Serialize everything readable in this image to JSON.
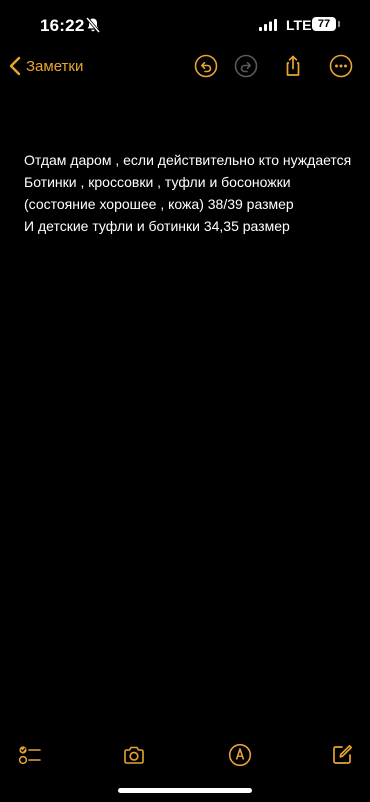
{
  "status_bar": {
    "time": "16:22",
    "network": "LTE",
    "battery": "77"
  },
  "nav": {
    "back_label": "Заметки",
    "accent_color": "#e8a532"
  },
  "note": {
    "lines": [
      "Отдам даром , если действительно кто нуждается",
      "Ботинки , кроссовки , туфли и босоножки (состояние хорошее , кожа) 38/39 размер",
      "И детские туфли и ботинки 34,35 размер"
    ]
  },
  "toolbar": {
    "icons": [
      "checklist-icon",
      "camera-icon",
      "markup-icon",
      "compose-icon"
    ]
  }
}
